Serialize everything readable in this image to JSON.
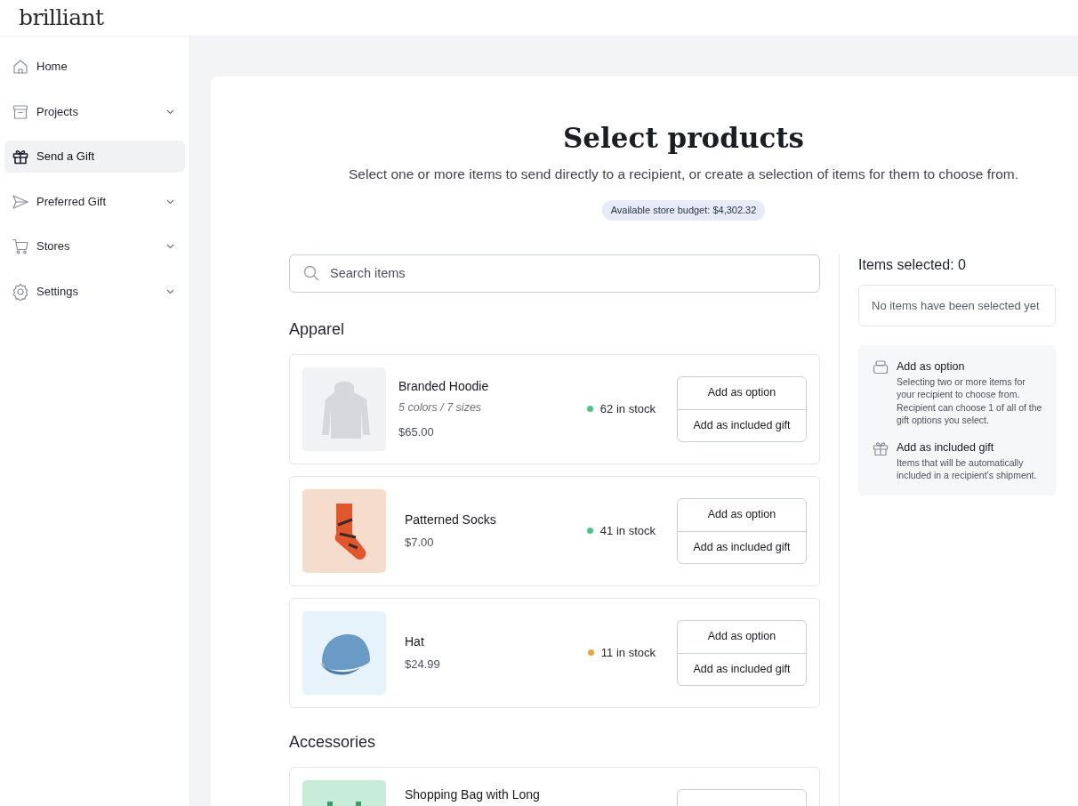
{
  "logo": "brilliant",
  "sidebar": {
    "items": [
      {
        "kind": "home",
        "label": "Home",
        "has_submenu": false,
        "selected": false
      },
      {
        "kind": "archive",
        "label": "Projects",
        "has_submenu": true,
        "selected": false
      },
      {
        "kind": "gift",
        "label": "Send a Gift",
        "has_submenu": false,
        "selected": true
      },
      {
        "kind": "send",
        "label": "Preferred Gift",
        "has_submenu": true,
        "selected": false
      },
      {
        "kind": "cart",
        "label": "Stores",
        "has_submenu": true,
        "selected": false
      },
      {
        "kind": "gear",
        "label": "Settings",
        "has_submenu": true,
        "selected": false
      }
    ]
  },
  "page": {
    "title": "Select products",
    "subtitle": "Select one or more items to send directly to a recipient, or create a selection of items for them to choose from.",
    "budget": "Available store budget: $4,302.32"
  },
  "search": {
    "placeholder": "Search items"
  },
  "sections": [
    {
      "title": "Apparel",
      "products": [
        {
          "kind": "hoodie",
          "name": "Branded Hoodie",
          "variants": "5 colors / 7 sizes",
          "price": "$65.00",
          "stock": "62 in stock",
          "color": "#4fc08d",
          "buttons": [
            "Add as option",
            "Add as included gift"
          ]
        },
        {
          "kind": "socks",
          "name": "Patterned Socks",
          "price": "$7.00",
          "stock": "41 in stock",
          "color": "#4fc08d",
          "buttons": [
            "Add as option",
            "Add as included gift"
          ]
        },
        {
          "kind": "hat",
          "name": "Hat",
          "price": "$24.99",
          "stock": "11 in stock",
          "color": "#e8a33d",
          "buttons": [
            "Add as option",
            "Add as included gift"
          ]
        }
      ]
    },
    {
      "title": "Accessories",
      "products": [
        {
          "kind": "bag",
          "name": "Shopping Bag with Long"
        }
      ]
    }
  ],
  "selection": {
    "title": "Items selected: 0",
    "empty": "No items have been selected yet",
    "help": [
      {
        "kind": "option",
        "title": "Add as option",
        "text": "Selecting two or more items for your recipient to choose from. Recipient can choose 1 of all of the gift options you select."
      },
      {
        "kind": "gift",
        "title": "Add as included gift",
        "text": "Items that will be automatically included in a recipient’s shipment."
      }
    ]
  }
}
